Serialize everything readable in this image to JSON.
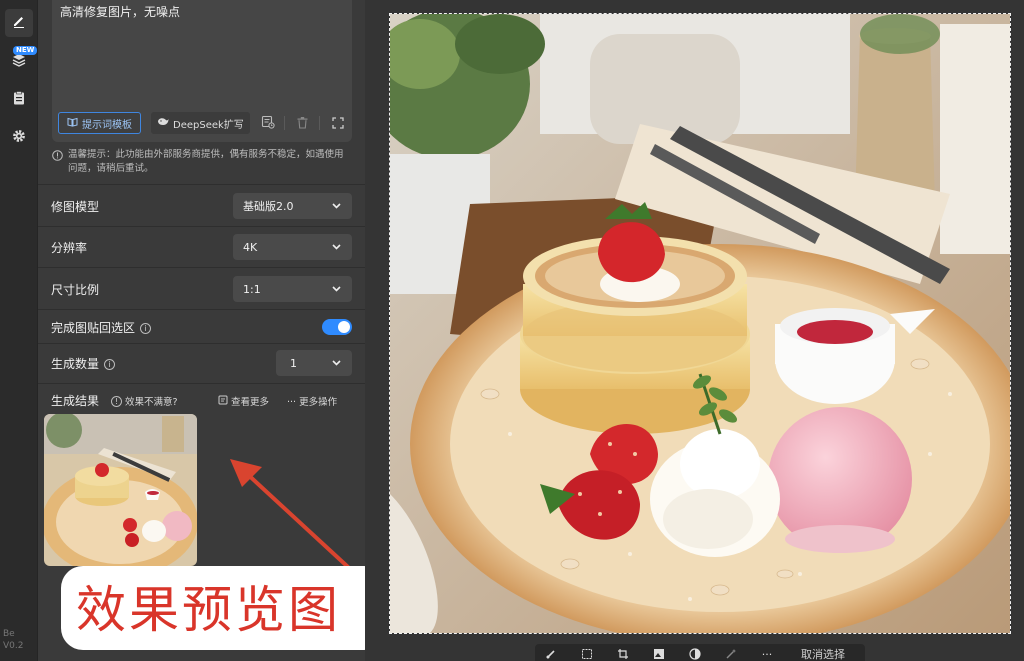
{
  "rail": {
    "items": [
      {
        "icon": "pen-icon",
        "active": true
      },
      {
        "icon": "layers-icon",
        "badge": "NEW"
      },
      {
        "icon": "clipboard-icon"
      },
      {
        "icon": "gear-icon"
      }
    ],
    "version": "Be\nV0.2"
  },
  "prompt": {
    "text": "高清修复图片，无噪点",
    "template_button": "提示词模板",
    "deepseek_button": "DeepSeek扩写"
  },
  "notice": "温馨提示：此功能由外部服务商提供，偶有服务不稳定，如遇使用问题，请稍后重试。",
  "settings": {
    "model": {
      "label": "修图模型",
      "value": "基础版2.0"
    },
    "resolution": {
      "label": "分辨率",
      "value": "4K"
    },
    "aspect": {
      "label": "尺寸比例",
      "value": "1:1"
    },
    "paste_back": {
      "label": "完成图贴回选区",
      "enabled": true
    },
    "count": {
      "label": "生成数量",
      "value": "1"
    }
  },
  "results": {
    "label": "生成结果",
    "unsatisfied": "效果不满意?",
    "view_more": "查看更多",
    "more_actions": "··· 更多操作"
  },
  "callout": {
    "text": "效果预览图"
  },
  "colors": {
    "accent": "#2f8bff",
    "callout_text": "#d9352a",
    "arrow": "#d9442f"
  },
  "bottom_toolbar": {
    "cancel_selection": "取消选择"
  }
}
